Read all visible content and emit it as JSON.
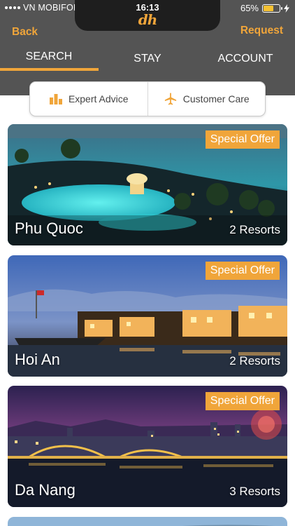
{
  "status_bar": {
    "carrier": "VN MOBIFONE",
    "time": "16:13",
    "battery": "65%",
    "battery_level": 0.65,
    "icons": [
      "signal-dots-icon",
      "wifi-icon",
      "battery-icon",
      "charging-bolt-icon"
    ]
  },
  "nav": {
    "logo": "dh",
    "back_label": "Back",
    "request_label": "Request"
  },
  "tabs": [
    {
      "label": "SEARCH",
      "active": true
    },
    {
      "label": "STAY",
      "active": false
    },
    {
      "label": "ACCOUNT",
      "active": false
    }
  ],
  "segment": {
    "expert_label": "Expert Advice",
    "expert_icon": "bar-chart-icon",
    "care_label": "Customer Care",
    "care_icon": "airplane-icon"
  },
  "destinations": [
    {
      "name": "Phu Quoc",
      "count": "2 Resorts",
      "badge": "Special Offer"
    },
    {
      "name": "Hoi An",
      "count": "2 Resorts",
      "badge": "Special Offer"
    },
    {
      "name": "Da Nang",
      "count": "3 Resorts",
      "badge": "Special Offer"
    }
  ],
  "colors": {
    "accent": "#f0a53a",
    "header_bg": "#545454",
    "notch": "#1e1e1e"
  }
}
